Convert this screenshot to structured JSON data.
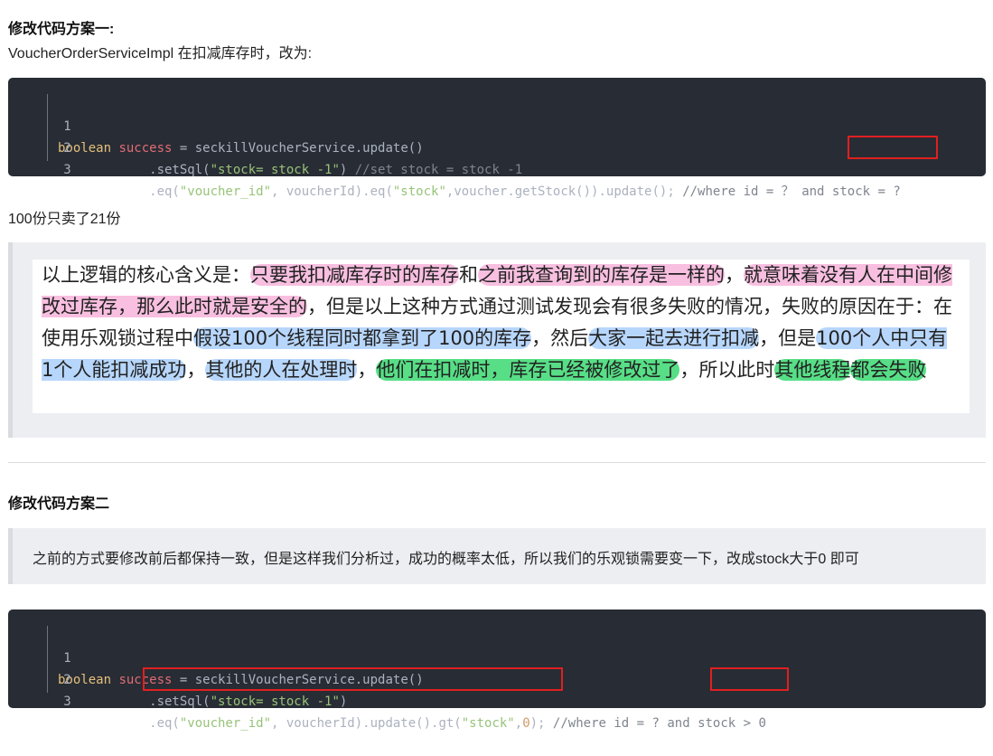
{
  "section1": {
    "heading": "修改代码方案一:",
    "intro": "VoucherOrderServiceImpl 在扣减库存时，改为:",
    "code": {
      "line_numbers": [
        "1",
        "2",
        "3"
      ],
      "l1": {
        "kw": "boolean",
        "var": "success",
        "rest": " = seckillVoucherService.update()"
      },
      "l2": {
        "pre": "            .setSql(",
        "str": "\"stock= stock -1\"",
        "post": ") ",
        "comment": "//set stock = stock -1"
      },
      "l3": {
        "pre": "            .eq(",
        "s1": "\"voucher_id\"",
        "mid": ", voucherId).eq(",
        "s2": "\"stock\"",
        "post": ",voucher.getStock()).update(); ",
        "comment": "//where id = ？ and stock = ?"
      }
    },
    "result": "100份只卖了21份"
  },
  "explanation": {
    "t1": "以上逻辑的核心含义是：",
    "h1": "只要我扣减库存时的库存",
    "t2": "和",
    "h2": "之前我查询到的库存是一样的",
    "t3": "，",
    "h3": "就意味着没有人在中间修改过库存，那么此时就是安全的",
    "t4": "，但是以上这种方式通过测试发现会有很多失败的情况，失败的原因在于：在使用乐观锁过程中",
    "h4": "假设100个线程同时都拿到了100的库存",
    "t5": "，然后",
    "h5": "大家一起去进行扣减",
    "t6": "，但是",
    "h6": "100个人中只有1个人能扣减成功",
    "t7": "，",
    "h7": "其他的人在处理时",
    "t8": "，",
    "h8": "他们在扣减时，库存已经被修改过了",
    "t9": "，所以此时",
    "h9": "其他线程",
    "h10": "都会失败"
  },
  "section2": {
    "heading": "修改代码方案二",
    "quote": "之前的方式要修改前后都保持一致，但是这样我们分析过，成功的概率太低，所以我们的乐观锁需要变一下，改成stock大于0 即可",
    "code": {
      "line_numbers": [
        "1",
        "2",
        "3"
      ],
      "l1": {
        "kw": "boolean",
        "var": "success",
        "rest": " = seckillVoucherService.update()"
      },
      "l2": {
        "pre": "            .setSql(",
        "str": "\"stock= stock -1\"",
        "post": ")"
      },
      "l3": {
        "pre": "            .eq(",
        "s1": "\"voucher_id\"",
        "mid": ", voucherId).update().gt(",
        "s2": "\"stock\"",
        "comma": ",",
        "num": "0",
        "post": "); ",
        "comment": "//where id = ? and stock > 0"
      }
    }
  }
}
